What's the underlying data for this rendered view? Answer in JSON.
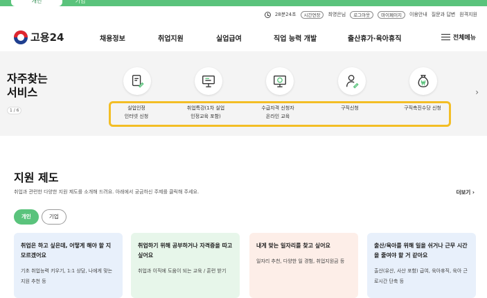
{
  "audience_tabs": {
    "personal": "개인",
    "business": "기업"
  },
  "utility": {
    "timer": "28분24초",
    "extend": "시간연장",
    "greeting": "최영은님",
    "logout": "로그아웃",
    "mypage": "마이페이지",
    "guide": "이용안내",
    "qna": "질문과 답변",
    "remote": "원격지원"
  },
  "logo": {
    "name": "고용24"
  },
  "nav": {
    "items": [
      "채용정보",
      "취업지원",
      "실업급여",
      "직업 능력 개발",
      "출산휴가·육아휴직"
    ],
    "all_menu": "전체메뉴"
  },
  "services": {
    "title_line1": "자주찾는",
    "title_line2": "서비스",
    "pager": "1 / 6",
    "items": [
      {
        "icon": "document-pen-icon",
        "line1": "실업인정",
        "line2": "인터넷 신청"
      },
      {
        "icon": "presentation-board-icon",
        "line1": "취업특강(1차 실업",
        "line2": "인정교육 포함)"
      },
      {
        "icon": "monitor-play-icon",
        "line1": "수급자격 신청자",
        "line2": "온라인 교육"
      },
      {
        "icon": "person-pen-icon",
        "line1": "구직신청",
        "line2": ""
      },
      {
        "icon": "money-bag-icon",
        "line1": "구직촉진수당 신청",
        "line2": ""
      }
    ]
  },
  "support": {
    "title": "지원 제도",
    "description": "취업과 관련한 다양한 지원 제도를 소개해 드려요. 아래에서 궁금하신 주제를 클릭해 주세요.",
    "more": "더보기",
    "tabs": [
      "개인",
      "기업"
    ],
    "cards": [
      {
        "title": "취업은 하고 싶은데, 어떻게 해야 할 지 모르겠어요",
        "desc": "기초 취업능력 키우기, 1:1 상담, 나에게 맞는 지원 추천 등",
        "bg": "#e8f0fb"
      },
      {
        "title": "취업하기 위해 공부하거나 자격증을 따고 싶어요",
        "desc": "취업과 이직에 도움이 되는 교육 / 훈련 받기",
        "bg": "#e7f6ea"
      },
      {
        "title": "내게 맞는 일자리를 찾고 싶어요",
        "desc": "일자리 추천, 다양한 일 경험, 취업지원금 등",
        "bg": "#fdeee8"
      },
      {
        "title": "출산/육아를 위해 일을 쉬거나 근무 시간을 줄여야 할 거 같아요",
        "desc": "출산(유산, 사산 포함) 급여, 육아휴직, 육아 근로시간 단축 등",
        "bg": "#e8f0fb"
      }
    ]
  },
  "colors": {
    "brand_green": "#5ac37c",
    "highlight": "#f3be25",
    "services_bg": "#f4f4f4"
  }
}
